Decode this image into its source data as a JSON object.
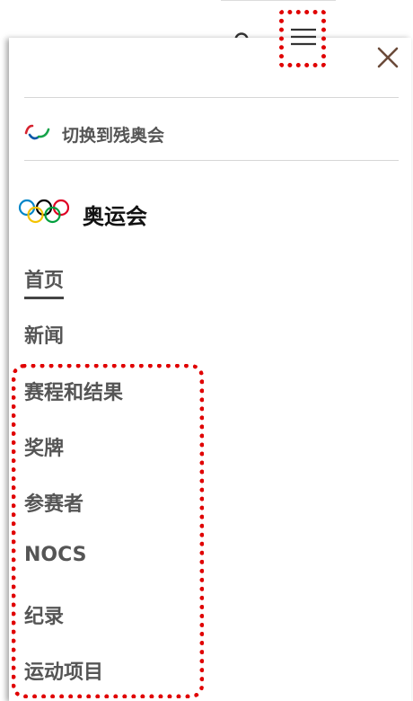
{
  "header": {
    "search_icon": "search-icon",
    "menu_icon": "hamburger-menu-icon",
    "close_icon": "close-icon"
  },
  "drawer": {
    "switch_label": "切换到残奥会",
    "brand_label": "奥运会",
    "nav_items": [
      {
        "label": "首页",
        "active": true
      },
      {
        "label": "新闻"
      },
      {
        "label": "赛程和结果"
      },
      {
        "label": "奖牌"
      },
      {
        "label": "参赛者"
      },
      {
        "label": "NOCS"
      },
      {
        "label": "纪录"
      },
      {
        "label": "运动项目"
      }
    ]
  },
  "colors": {
    "highlight": "#e00000",
    "text": "#555555",
    "paralympic_red": "#d6232f",
    "paralympic_blue": "#0b57a8",
    "paralympic_green": "#16a34a",
    "olympic_blue": "#0085c7",
    "olympic_yellow": "#f4c300",
    "olympic_black": "#000000",
    "olympic_green": "#009f3d",
    "olympic_red": "#df0024"
  }
}
